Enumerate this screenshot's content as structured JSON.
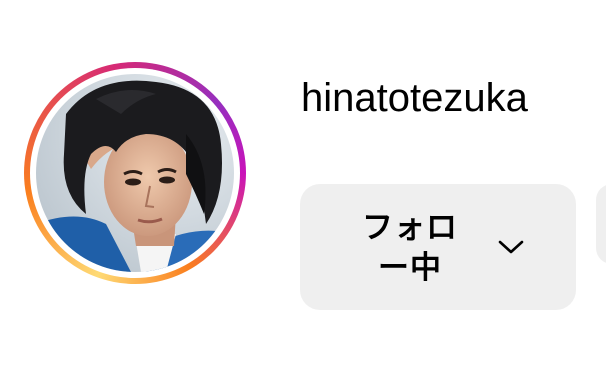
{
  "profile": {
    "username": "hinatotezuka",
    "avatar_icon": "profile-photo",
    "story_ring_colors": [
      "#feda75",
      "#fa7e1e",
      "#d62976",
      "#962fbf",
      "#c913b9"
    ]
  },
  "actions": {
    "follow_label_line1": "フォロ",
    "follow_label_line2": "ー中",
    "follow_chevron_icon": "chevron-down-icon",
    "button_bg": "#efefef"
  }
}
